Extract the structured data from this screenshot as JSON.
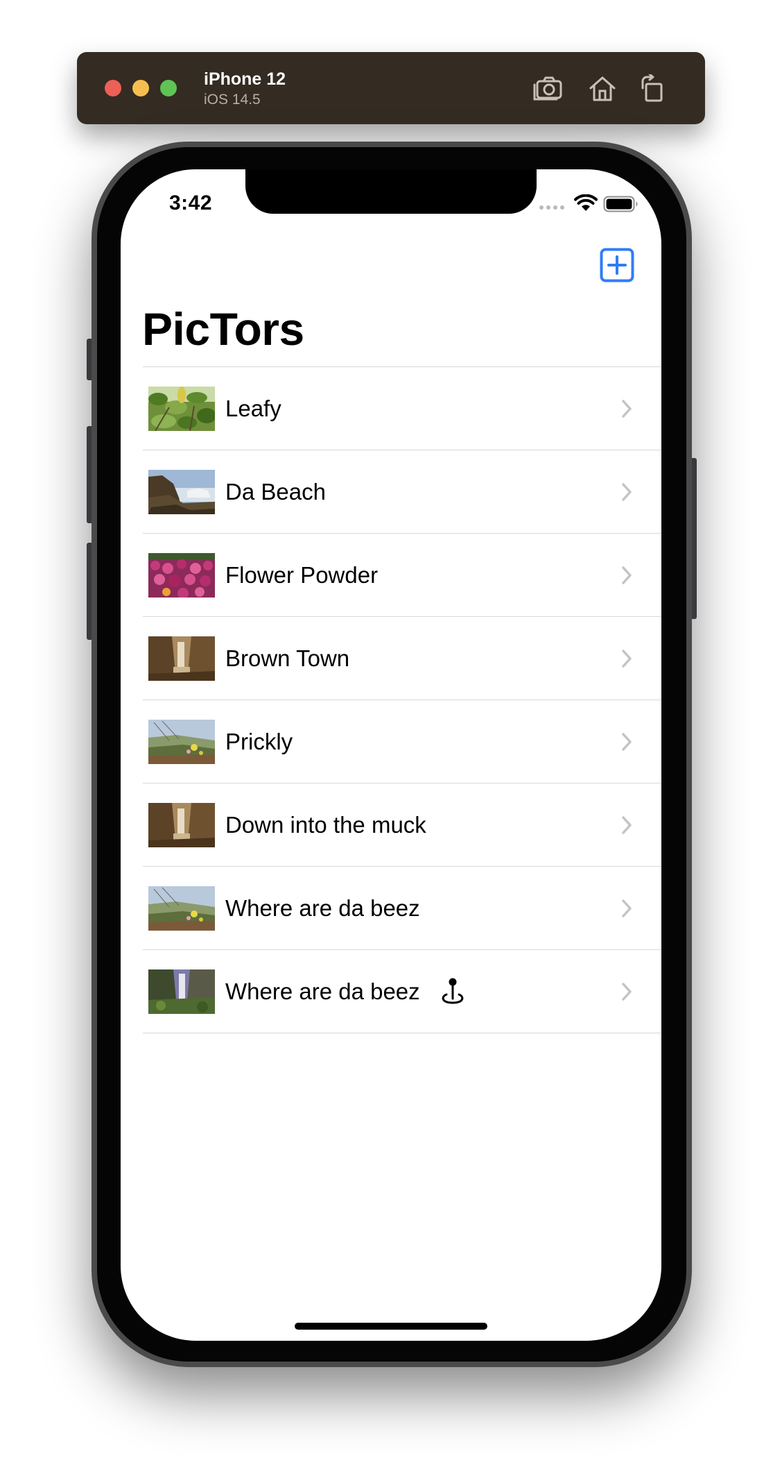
{
  "simulator": {
    "device_name": "iPhone 12",
    "os_version": "iOS 14.5",
    "tools": [
      {
        "icon": "camera-icon"
      },
      {
        "icon": "home-icon"
      },
      {
        "icon": "rotate-icon"
      }
    ]
  },
  "status_bar": {
    "time": "3:42",
    "icons": [
      "cellular-signal-icon",
      "wifi-icon",
      "battery-icon"
    ]
  },
  "nav": {
    "add_icon": "plus-square-icon",
    "accent_color": "#2f7df6",
    "title": "PicTors"
  },
  "photos": [
    {
      "title": "Leafy",
      "thumbnail": "leaves"
    },
    {
      "title": "Da Beach",
      "thumbnail": "beach-cliff"
    },
    {
      "title": "Flower Powder",
      "thumbnail": "pink-flowers"
    },
    {
      "title": "Brown Town",
      "thumbnail": "sepia-waterfall"
    },
    {
      "title": "Prickly",
      "thumbnail": "hillside-flowers"
    },
    {
      "title": "Down into the muck",
      "thumbnail": "sepia-waterfall"
    },
    {
      "title": "Where are da beez",
      "thumbnail": "hillside-flowers"
    },
    {
      "title": "Where are da beez",
      "thumbnail": "canyon-waterfall",
      "has_location": true,
      "location_icon": "map-pin-icon"
    }
  ],
  "row_accessory": "chevron-right-icon"
}
